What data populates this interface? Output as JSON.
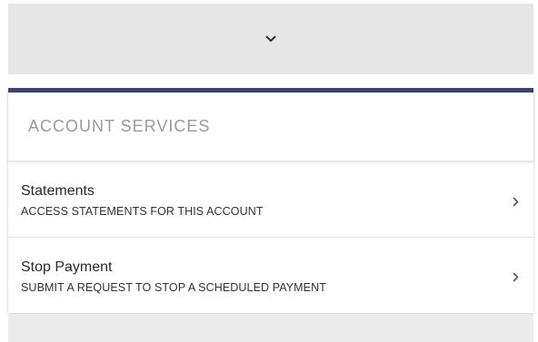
{
  "expand_toggle": {
    "icon": "chevron-down-icon"
  },
  "account_services": {
    "title": "ACCOUNT SERVICES",
    "accent_color": "#3b4470",
    "items": [
      {
        "title": "Statements",
        "description": "ACCESS STATEMENTS FOR THIS ACCOUNT",
        "icon": "chevron-right-icon"
      },
      {
        "title": "Stop Payment",
        "description": "SUBMIT A REQUEST TO STOP A SCHEDULED PAYMENT",
        "icon": "chevron-right-icon"
      }
    ]
  }
}
